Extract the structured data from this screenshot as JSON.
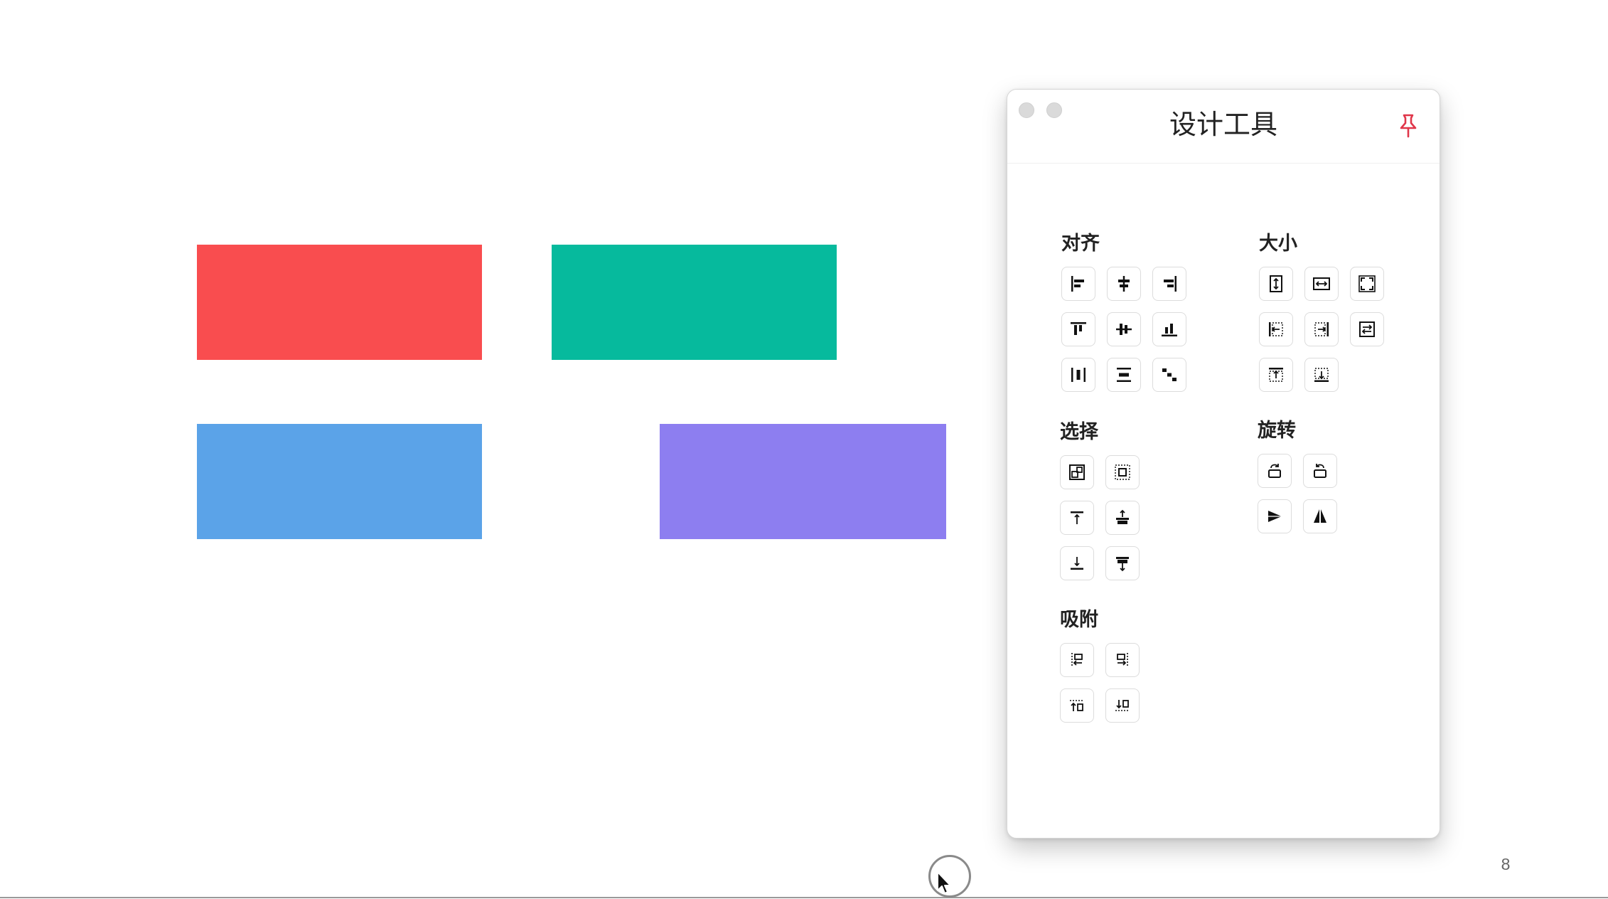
{
  "canvas": {
    "shapes": [
      {
        "name": "red-rectangle",
        "color": "#f94d4f"
      },
      {
        "name": "teal-rectangle",
        "color": "#06ba9d"
      },
      {
        "name": "blue-rectangle",
        "color": "#5ba3e8"
      },
      {
        "name": "purple-rectangle",
        "color": "#8d7ef0"
      }
    ],
    "page_number": "8"
  },
  "panel": {
    "title": "设计工具",
    "pin_icon": "pin-icon",
    "pin_color": "#e0364a",
    "sections": {
      "align": {
        "title": "对齐",
        "icons": [
          "align-left-icon",
          "align-horizontal-center-icon",
          "align-right-icon",
          "align-top-icon",
          "align-vertical-center-icon",
          "align-bottom-icon",
          "distribute-horizontal-icon",
          "distribute-vertical-icon",
          "stagger-icon"
        ]
      },
      "size": {
        "title": "大小",
        "icons": [
          "match-height-icon",
          "match-width-icon",
          "match-size-icon",
          "stretch-left-icon",
          "stretch-right-icon",
          "swap-size-icon",
          "stretch-top-icon",
          "stretch-bottom-icon"
        ]
      },
      "select": {
        "title": "选择",
        "icons": [
          "select-same-type-icon",
          "select-within-icon",
          "select-above-icon",
          "select-same-level-icon",
          "select-below-icon",
          "select-overlap-icon"
        ]
      },
      "rotate": {
        "title": "旋转",
        "icons": [
          "rotate-left-icon",
          "rotate-right-icon",
          "flip-horizontal-icon",
          "flip-vertical-icon"
        ]
      },
      "snap": {
        "title": "吸附",
        "icons": [
          "snap-left-icon",
          "snap-right-icon",
          "snap-top-icon",
          "snap-bottom-icon"
        ]
      }
    }
  }
}
